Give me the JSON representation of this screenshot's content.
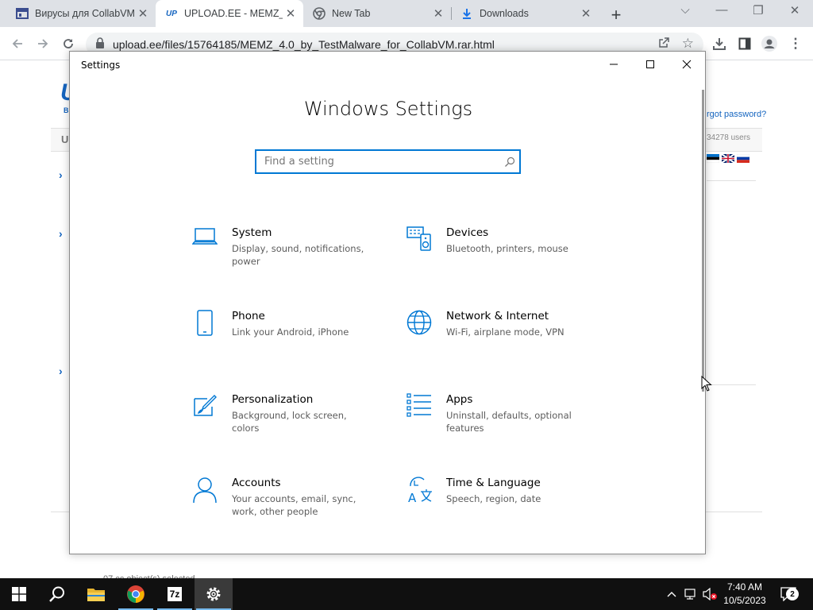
{
  "browser": {
    "tabs": [
      {
        "title": "Вирусы для CollabVM",
        "favicon": "page-icon",
        "active": false
      },
      {
        "title": "UPLOAD.EE - MEMZ_4",
        "favicon": "upload-ee-icon",
        "active": true
      },
      {
        "title": "New Tab",
        "favicon": "chrome-icon",
        "active": false
      },
      {
        "title": "Downloads",
        "favicon": "download-icon",
        "active": false
      }
    ],
    "url": "upload.ee/files/15764185/MEMZ_4.0_by_TestMalware_for_CollabVM.rar.html"
  },
  "background_page": {
    "logo_text": "U",
    "logo_sub": "B",
    "nav_label": "U",
    "forgot_password": "rgot password?",
    "users_count": "34278 users",
    "status_text": "07 cc object(s) selected"
  },
  "settings": {
    "window_title": "Settings",
    "heading": "Windows Settings",
    "search_placeholder": "Find a setting",
    "accent_color": "#0078d4",
    "categories": [
      {
        "name": "System",
        "description": "Display, sound, notifications, power",
        "icon": "laptop-icon"
      },
      {
        "name": "Devices",
        "description": "Bluetooth, printers, mouse",
        "icon": "devices-icon"
      },
      {
        "name": "Phone",
        "description": "Link your Android, iPhone",
        "icon": "phone-icon"
      },
      {
        "name": "Network & Internet",
        "description": "Wi-Fi, airplane mode, VPN",
        "icon": "globe-icon"
      },
      {
        "name": "Personalization",
        "description": "Background, lock screen, colors",
        "icon": "brush-icon"
      },
      {
        "name": "Apps",
        "description": "Uninstall, defaults, optional features",
        "icon": "apps-list-icon"
      },
      {
        "name": "Accounts",
        "description": "Your accounts, email, sync, work, other people",
        "icon": "person-icon"
      },
      {
        "name": "Time & Language",
        "description": "Speech, region, date",
        "icon": "time-language-icon"
      }
    ]
  },
  "taskbar": {
    "time": "7:40 AM",
    "date": "10/5/2023",
    "notification_count": "2",
    "apps": [
      "start-icon",
      "search-icon",
      "file-explorer-icon",
      "chrome-icon",
      "7zip-icon",
      "settings-gear-icon"
    ],
    "seven_zip_label": "7z"
  }
}
